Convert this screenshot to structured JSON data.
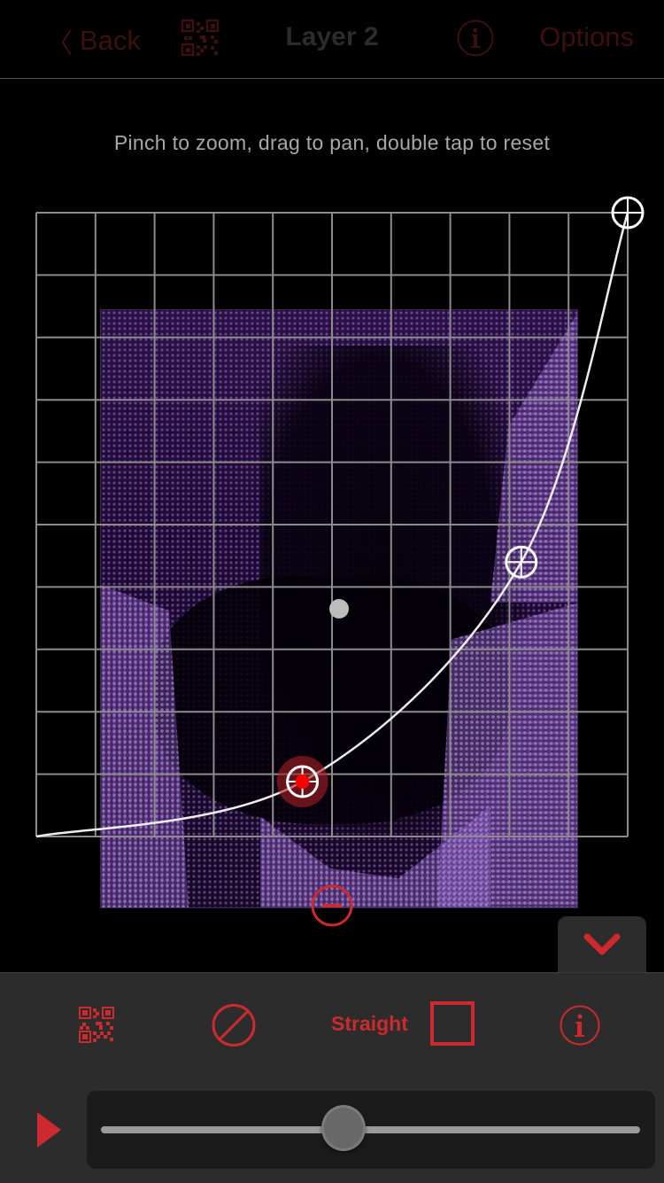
{
  "nav": {
    "back_label": "Back",
    "back_chevron": "〈",
    "title": "Layer 2",
    "options_label": "Options",
    "qr_icon": "qr-code-icon",
    "info_icon": "info-icon"
  },
  "hint": "Pinch to zoom, drag to pan, double tap to reset",
  "curve_editor": {
    "grid_columns": 10,
    "grid_rows": 10,
    "control_points": [
      {
        "name": "start",
        "x": 0.0,
        "y": 0.0
      },
      {
        "name": "selected",
        "x": 0.45,
        "y": 0.088,
        "selected": true
      },
      {
        "name": "mid",
        "x": 0.82,
        "y": 0.44
      },
      {
        "name": "end",
        "x": 1.0,
        "y": 1.0
      }
    ],
    "anchor_color": "#bdbdbd",
    "selected_color": "#ff0000",
    "grid_color": "#8c8c8c"
  },
  "toolbar": {
    "collapse_icon": "chevron-down-icon",
    "qr_icon": "qr-code-icon",
    "reset_icon": "prohibit-icon",
    "straight_label": "Straight",
    "straight_checked": false,
    "info_icon": "info-icon",
    "accent": "#cc2a2e"
  },
  "playback": {
    "play_icon": "play-icon",
    "slider_value": 0.45
  }
}
